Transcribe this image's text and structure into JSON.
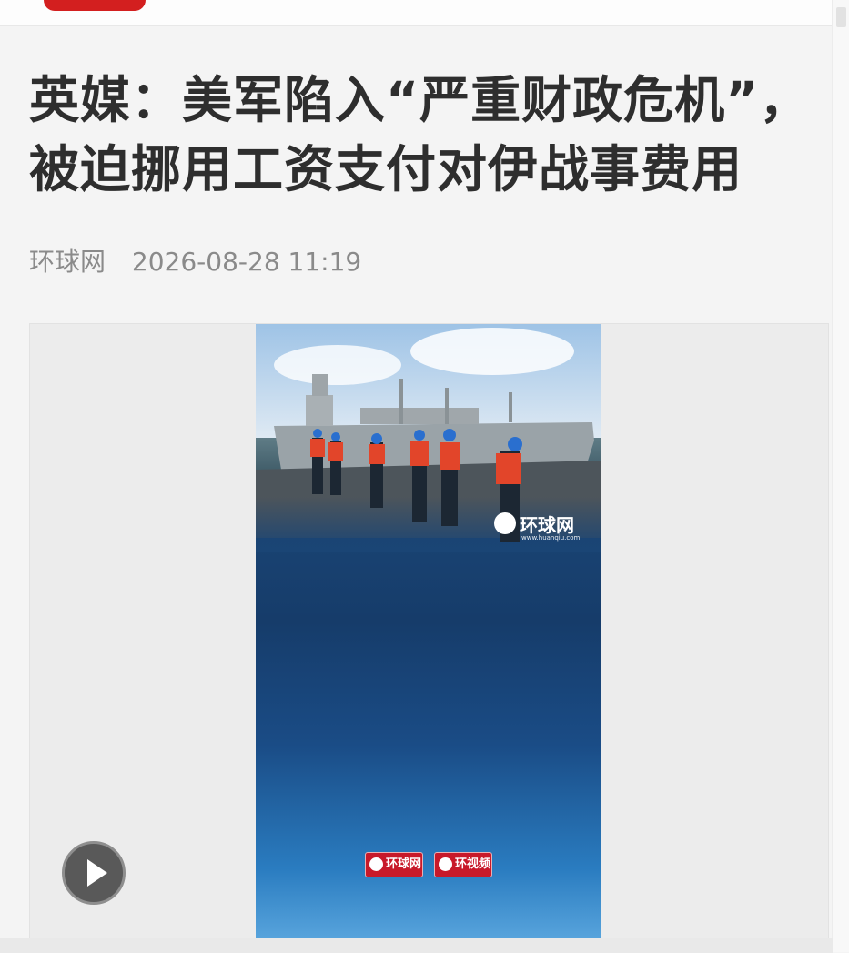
{
  "article": {
    "title": "英媒：美军陷入“严重财政危机”，被迫挪用工资支付对伊战事费用",
    "source": "环球网",
    "datetime": "2026-08-28 11:19"
  },
  "video": {
    "watermark_logo": "环球网",
    "watermark_url": "www.huanqiu.com",
    "badges": [
      "环球网",
      "环视频"
    ]
  },
  "colors": {
    "brand_red": "#d31f1f",
    "title_text": "#2e2e2e",
    "meta_text": "#8a8a8a",
    "page_bg": "#f4f4f4"
  },
  "icons": {
    "play": "play-icon"
  }
}
